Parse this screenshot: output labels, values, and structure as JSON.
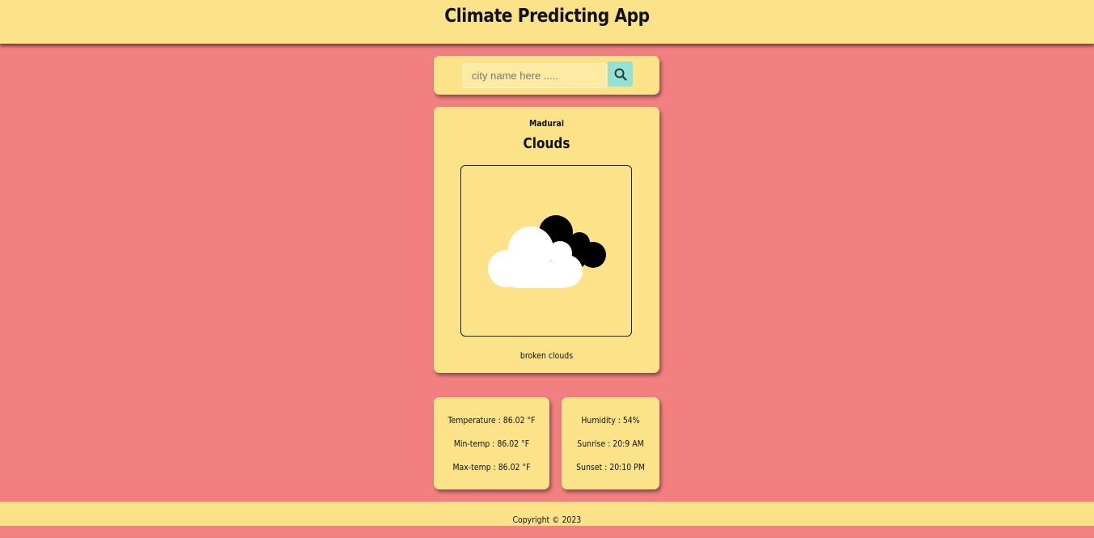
{
  "header": {
    "title": "Climate Predicting App"
  },
  "search": {
    "placeholder": "city name here .....",
    "value": "",
    "button_icon": "search-icon"
  },
  "weather": {
    "city": "Madurai",
    "condition": "Clouds",
    "icon": "broken-clouds-icon",
    "description": "broken clouds"
  },
  "stats_left": {
    "temperature": "Temperature : 86.02 °F",
    "min_temp": "Min-temp : 86.02 °F",
    "max_temp": "Max-temp : 86.02 °F"
  },
  "stats_right": {
    "humidity": "Humidity : 54%",
    "sunrise": "Sunrise : 20:9 AM",
    "sunset": "Sunset : 20:10 PM"
  },
  "footer": {
    "copyright": "Copyright © 2023"
  },
  "colors": {
    "background": "#f28080",
    "panel": "#fce38a",
    "search_button": "#95e1d3"
  }
}
